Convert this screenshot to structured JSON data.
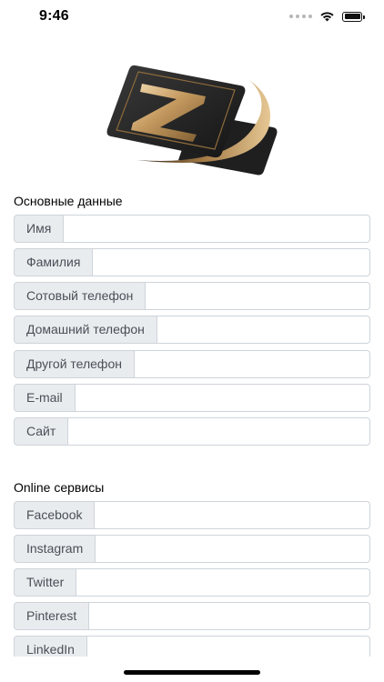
{
  "status_bar": {
    "time": "9:46",
    "icons": [
      "signal-dots-icon",
      "wifi-icon",
      "battery-icon"
    ]
  },
  "logo": {
    "icon": "z-card-logo-icon",
    "colors": {
      "card": "#262626",
      "gold": "#b8925a",
      "gold_light": "#d9b98a"
    }
  },
  "basic": {
    "title": "Основные данные",
    "fields": [
      {
        "label": "Имя",
        "value": ""
      },
      {
        "label": "Фамилия",
        "value": ""
      },
      {
        "label": "Сотовый телефон",
        "value": ""
      },
      {
        "label": "Домашний телефон",
        "value": ""
      },
      {
        "label": "Другой телефон",
        "value": ""
      },
      {
        "label": "E-mail",
        "value": ""
      },
      {
        "label": "Сайт",
        "value": ""
      }
    ]
  },
  "online": {
    "title": "Online сервисы",
    "fields": [
      {
        "label": "Facebook",
        "value": ""
      },
      {
        "label": "Instagram",
        "value": ""
      },
      {
        "label": "Twitter",
        "value": ""
      },
      {
        "label": "Pinterest",
        "value": ""
      },
      {
        "label": "LinkedIn",
        "value": ""
      }
    ]
  },
  "colors": {
    "label_bg": "#e9ecef",
    "border": "#ced4da",
    "label_text": "#495057"
  }
}
